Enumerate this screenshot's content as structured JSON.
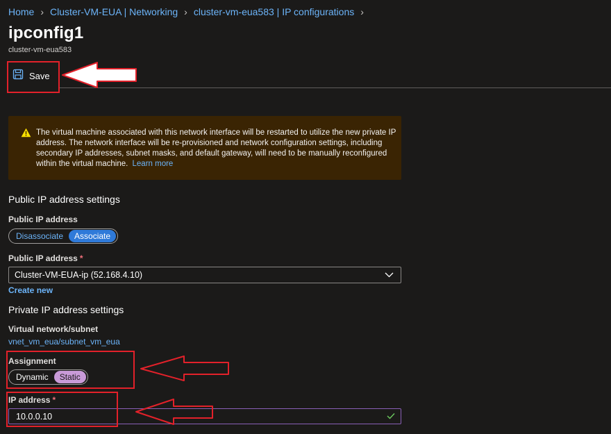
{
  "breadcrumb": {
    "items": [
      "Home",
      "Cluster-VM-EUA | Networking",
      "cluster-vm-eua583 | IP configurations"
    ]
  },
  "header": {
    "title": "ipconfig1",
    "subtitle": "cluster-vm-eua583"
  },
  "toolbar": {
    "save_label": "Save"
  },
  "warning": {
    "text": "The virtual machine associated with this network interface will be restarted to utilize the new private IP address. The network interface will be re-provisioned and network configuration settings, including secondary IP addresses, subnet masks, and default gateway, will need to be manually reconfigured within the virtual machine.",
    "link": "Learn more"
  },
  "public_ip": {
    "section_title": "Public IP address settings",
    "toggle_label": "Public IP address",
    "options": [
      "Disassociate",
      "Associate"
    ],
    "selected": "Associate",
    "select_label": "Public IP address",
    "select_value": "Cluster-VM-EUA-ip (52.168.4.10)",
    "create_new": "Create new"
  },
  "private_ip": {
    "section_title": "Private IP address settings",
    "vnet_label": "Virtual network/subnet",
    "vnet_value": "vnet_vm_eua/subnet_vm_eua",
    "assignment_label": "Assignment",
    "assignment_options": [
      "Dynamic",
      "Static"
    ],
    "assignment_selected": "Static",
    "ip_label": "IP address",
    "ip_value": "10.0.0.10"
  },
  "required_marker": "*",
  "colors": {
    "background": "#1b1a19",
    "link": "#6cb4f9",
    "accent": "#2f7ad9",
    "selected_static": "#c99bd8",
    "warning_bg": "#3a2403",
    "warning_icon": "#fce100",
    "annotation_red": "#e3212a",
    "valid_check": "#6ccb5f"
  },
  "icons": {
    "save": "save-icon",
    "warning": "warning-icon",
    "dropdown": "chevron-down-icon",
    "valid": "checkmark-icon",
    "breadcrumb_separator": "chevron-right-icon"
  }
}
